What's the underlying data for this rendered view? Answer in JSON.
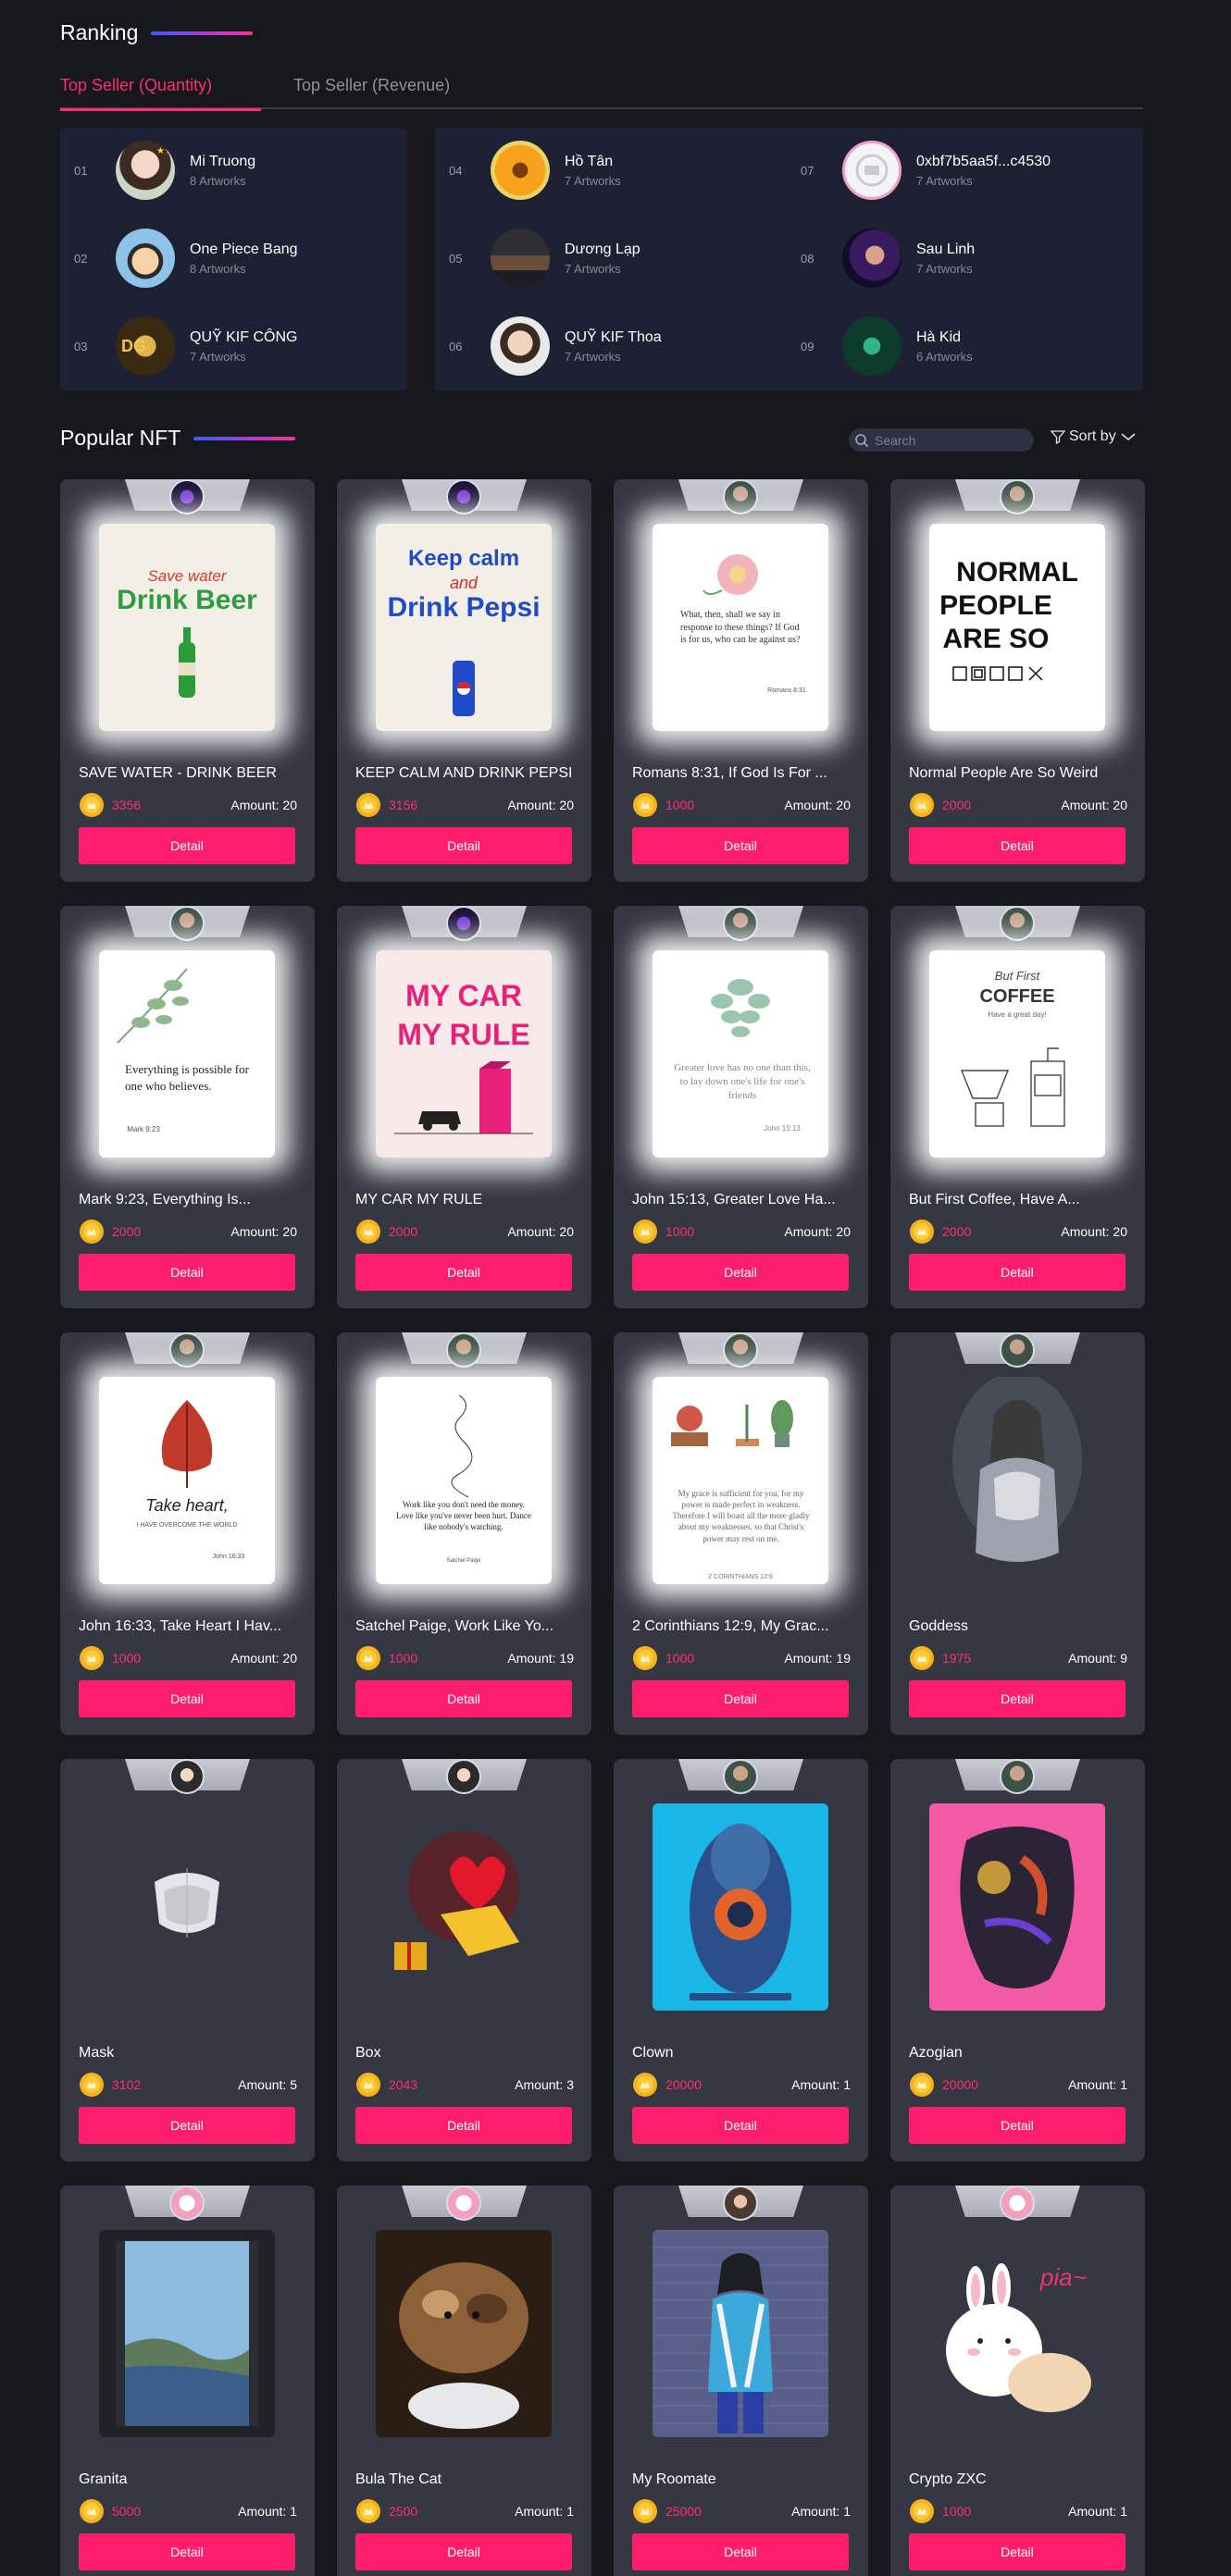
{
  "ranking": {
    "title": "Ranking",
    "tabs": [
      {
        "label": "Top Seller (Quantity)",
        "active": true
      },
      {
        "label": "Top Seller (Revenue)",
        "active": false
      }
    ],
    "sellers": [
      {
        "rank": "01",
        "name": "Mi Truong",
        "artworks": "8 Artworks"
      },
      {
        "rank": "02",
        "name": "One Piece Bang",
        "artworks": "8 Artworks"
      },
      {
        "rank": "03",
        "name": "QUỸ KIF CÔNG",
        "artworks": "7 Artworks"
      },
      {
        "rank": "04",
        "name": "Hồ Tân",
        "artworks": "7 Artworks"
      },
      {
        "rank": "05",
        "name": "Dương Lạp",
        "artworks": "7 Artworks"
      },
      {
        "rank": "06",
        "name": "QUỸ KIF Thoa",
        "artworks": "7 Artworks"
      },
      {
        "rank": "07",
        "name": "0xbf7b5aa5f...c4530",
        "artworks": "7 Artworks"
      },
      {
        "rank": "08",
        "name": "Sau Linh",
        "artworks": "7 Artworks"
      },
      {
        "rank": "09",
        "name": "Hà Kid",
        "artworks": "6 Artworks"
      }
    ]
  },
  "popular": {
    "title": "Popular NFT",
    "search_placeholder": "Search",
    "sort_label": "Sort by",
    "detail_label": "Detail",
    "items": [
      {
        "title": "SAVE WATER - DRINK BEER",
        "price": "3356",
        "amount": "Amount: 20"
      },
      {
        "title": "KEEP CALM AND DRINK PEPSI",
        "price": "3156",
        "amount": "Amount: 20"
      },
      {
        "title": "Romans 8:31, If God Is For ...",
        "price": "1000",
        "amount": "Amount: 20"
      },
      {
        "title": "Normal People Are So Weird",
        "price": "2000",
        "amount": "Amount: 20"
      },
      {
        "title": "Mark 9:23, Everything Is...",
        "price": "2000",
        "amount": "Amount: 20"
      },
      {
        "title": "MY CAR MY RULE",
        "price": "2000",
        "amount": "Amount: 20"
      },
      {
        "title": "John 15:13, Greater Love Ha...",
        "price": "1000",
        "amount": "Amount: 20"
      },
      {
        "title": "But First Coffee, Have A...",
        "price": "2000",
        "amount": "Amount: 20"
      },
      {
        "title": "John 16:33, Take Heart I Hav...",
        "price": "1000",
        "amount": "Amount: 20"
      },
      {
        "title": "Satchel Paige, Work Like Yo...",
        "price": "1000",
        "amount": "Amount: 19"
      },
      {
        "title": "2 Corinthians 12:9, My Grac...",
        "price": "1000",
        "amount": "Amount: 19"
      },
      {
        "title": "Goddess",
        "price": "1975",
        "amount": "Amount: 9"
      },
      {
        "title": "Mask",
        "price": "3102",
        "amount": "Amount: 5"
      },
      {
        "title": "Box",
        "price": "2043",
        "amount": "Amount: 3"
      },
      {
        "title": "Clown",
        "price": "20000",
        "amount": "Amount: 1"
      },
      {
        "title": "Azogian",
        "price": "20000",
        "amount": "Amount: 1"
      },
      {
        "title": "Granita",
        "price": "5000",
        "amount": "Amount: 1"
      },
      {
        "title": "Bula The Cat",
        "price": "2500",
        "amount": "Amount: 1"
      },
      {
        "title": "My Roomate",
        "price": "25000",
        "amount": "Amount: 1"
      },
      {
        "title": "Crypto ZXC",
        "price": "1000",
        "amount": "Amount: 1"
      }
    ],
    "art_text": {
      "beer_top": "Save water",
      "beer_main": "Drink Beer",
      "pepsi_1": "Keep calm",
      "pepsi_2": "and",
      "pepsi_3": "Drink Pepsi",
      "romans": "What, then, shall we say in response to these things? If God is for us, who can be against us?",
      "romans_ref": "Romans 8:31",
      "normal_1": "NORMAL",
      "normal_2": "PEOPLE",
      "normal_3": "ARE SO",
      "mark": "Everything is possible for one who believes.",
      "mark_ref": "Mark 9:23",
      "car_1": "MY CAR",
      "car_2": "MY RULE",
      "john15": "Greater love has no one than this, to lay down one's life for one's friends",
      "john15_ref": "John 15:13",
      "coffee_1": "But First",
      "coffee_2": "COFFEE",
      "coffee_3": "Have a great day!",
      "john16": "Take heart,",
      "john16_sub": "I HAVE OVERCOME THE WORLD",
      "john16_ref": "John 16:33",
      "paige": "Work like you don't need the money. Love like you've never been hurt. Dance like nobody's watching.",
      "paige_ref": "Satchel Paige",
      "cor": "My grace is sufficient for you, for my power is made perfect in weakness. Therefore I will boast all the more gladly about my weaknesses, so that Christ's power may rest on me.",
      "cor_ref": "2 CORINTHIANS 12:9",
      "crypto_pia": "pia~"
    },
    "colors": {
      "accent": "#ff1e6b",
      "price": "#ff2e6e",
      "card": "#353743",
      "panel": "#1d2133"
    }
  }
}
